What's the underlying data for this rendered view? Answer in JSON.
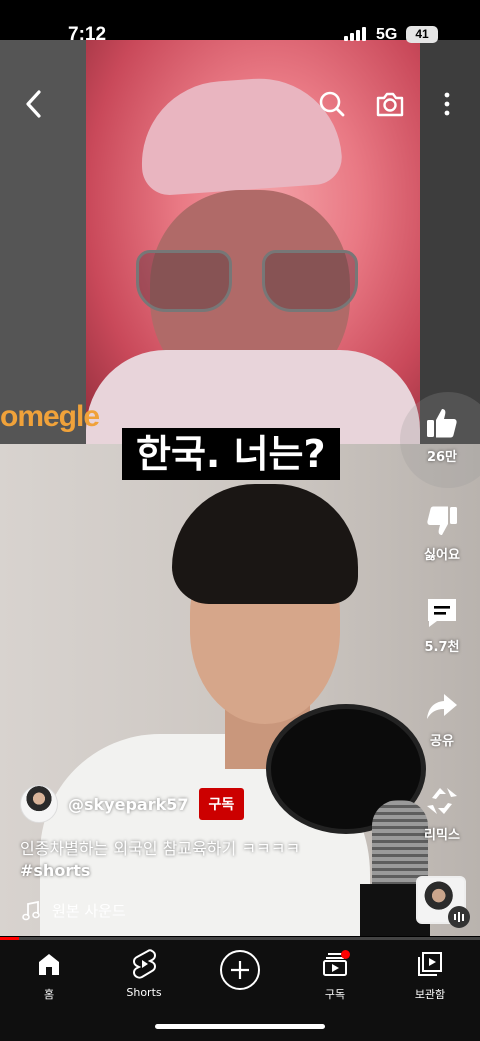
{
  "status_bar": {
    "time": "7:12",
    "network": "5G",
    "battery": "41"
  },
  "video": {
    "caption": "한국. 너는?",
    "watermark": "omegle"
  },
  "actions": {
    "like_count": "26만",
    "dislike_label": "싫어요",
    "comment_count": "5.7천",
    "share_label": "공유",
    "remix_label": "리믹스"
  },
  "channel": {
    "handle": "@skyepark57",
    "subscribe_label": "구독"
  },
  "title": {
    "text": "인종차별하는 외국인 참교육하기 ㅋㅋㅋㅋ",
    "hashtag": "#shorts"
  },
  "sound": {
    "label": "원본 사운드"
  },
  "progress": {
    "fraction": 0.04
  },
  "nav": {
    "home": "홈",
    "shorts": "Shorts",
    "subscriptions": "구독",
    "library": "보관함"
  },
  "colors": {
    "accent": "#ff0000",
    "subscribe_bg": "#cc0000"
  }
}
